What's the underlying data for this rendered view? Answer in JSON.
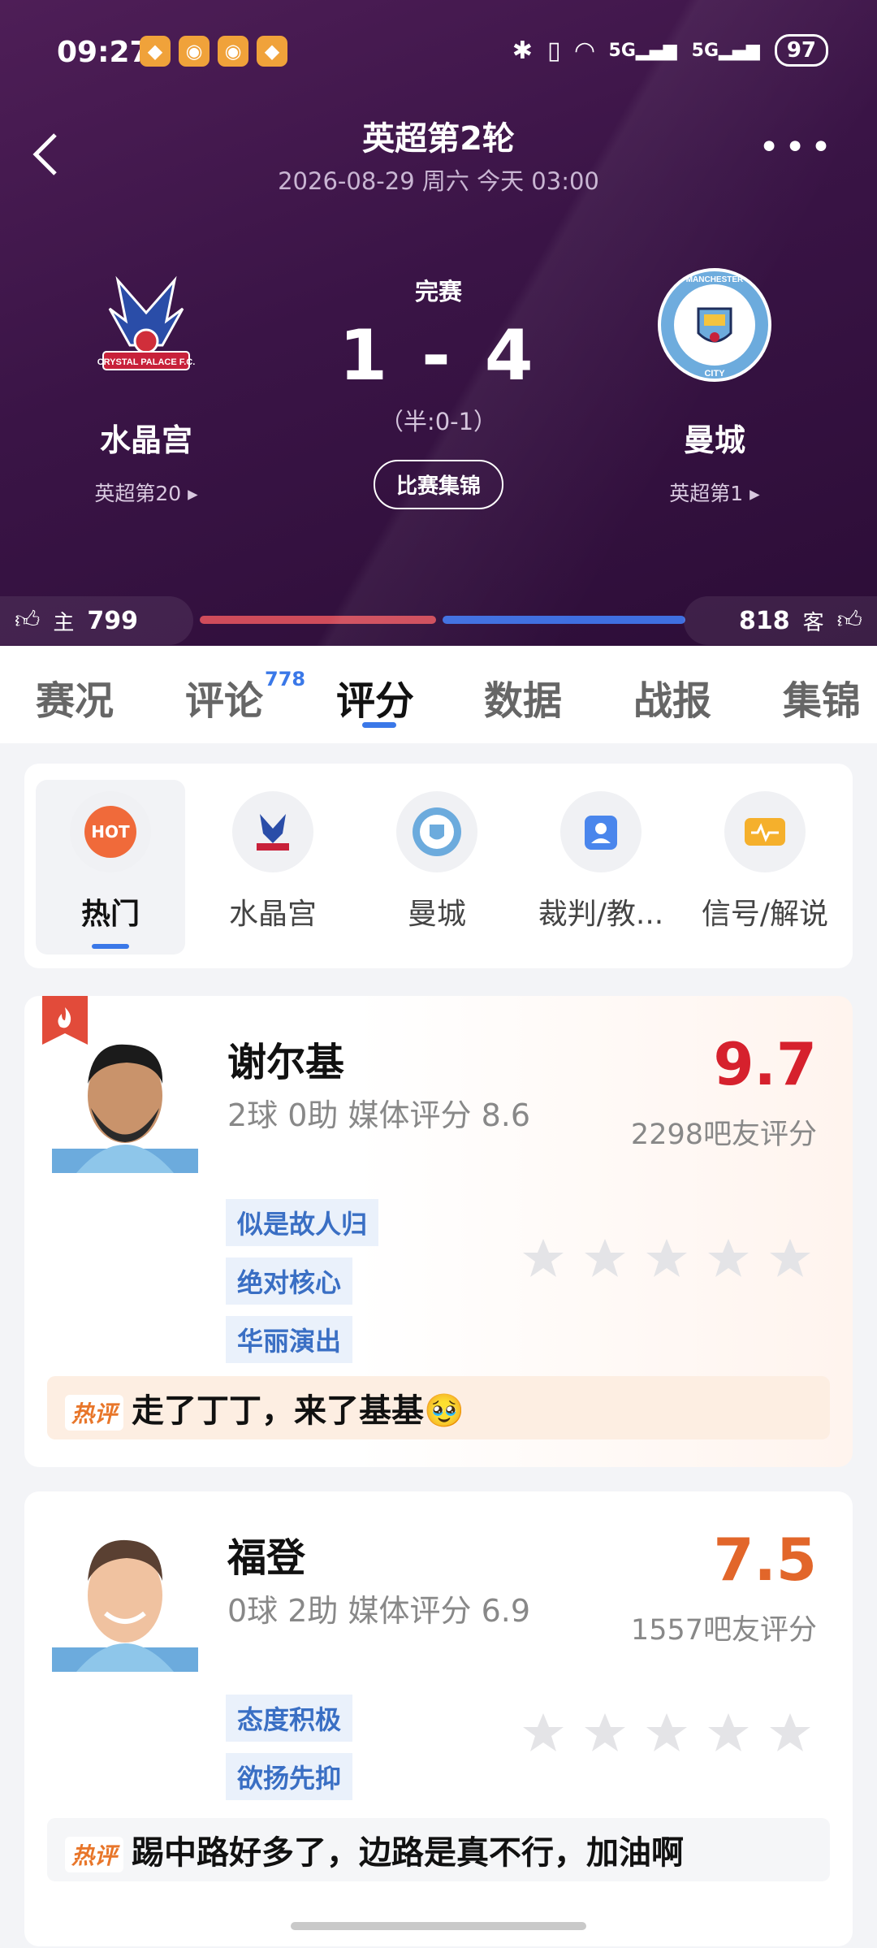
{
  "status_bar": {
    "time": "09:27",
    "signal1": "5G",
    "signal2": "5G",
    "battery": "97"
  },
  "header": {
    "title": "英超第2轮",
    "datetime": "2026-08-29 周六 今天 03:00",
    "status": "完赛",
    "score": "1 - 4",
    "halftime": "（半:0-1）",
    "highlights_button": "比赛集锦",
    "home": {
      "name": "水晶宫",
      "rank": "英超第20"
    },
    "away": {
      "name": "曼城",
      "rank": "英超第1"
    },
    "likes": {
      "home_label": "主",
      "home_count": "799",
      "away_label": "客",
      "away_count": "818",
      "home_ratio": 0.494
    }
  },
  "tabs": [
    {
      "label": "赛况"
    },
    {
      "label": "评论",
      "badge": "778"
    },
    {
      "label": "评分"
    },
    {
      "label": "数据"
    },
    {
      "label": "战报"
    },
    {
      "label": "集锦"
    }
  ],
  "filters": [
    {
      "label": "热门",
      "icon": "HOT"
    },
    {
      "label": "水晶宫",
      "icon": "crystal-palace-crest"
    },
    {
      "label": "曼城",
      "icon": "man-city-crest"
    },
    {
      "label": "裁判/教...",
      "icon": "referee-icon"
    },
    {
      "label": "信号/解说",
      "icon": "video-icon"
    }
  ],
  "players": [
    {
      "name": "谢尔基",
      "stats": "2球 0助  媒体评分 8.6",
      "rating": "9.7",
      "rating_color": "#d6212d",
      "fans": "2298吧友评分",
      "tags": [
        "似是故人归",
        "绝对核心",
        "华丽演出"
      ],
      "comment_label": "热评",
      "comment": "走了丁丁，来了基基🥹"
    },
    {
      "name": "福登",
      "stats": "0球 2助  媒体评分 6.9",
      "rating": "7.5",
      "rating_color": "#e2662a",
      "fans": "1557吧友评分",
      "tags": [
        "态度积极",
        "欲扬先抑"
      ],
      "comment_label": "热评",
      "comment": "踢中路好多了，边路是真不行，加油啊"
    }
  ]
}
